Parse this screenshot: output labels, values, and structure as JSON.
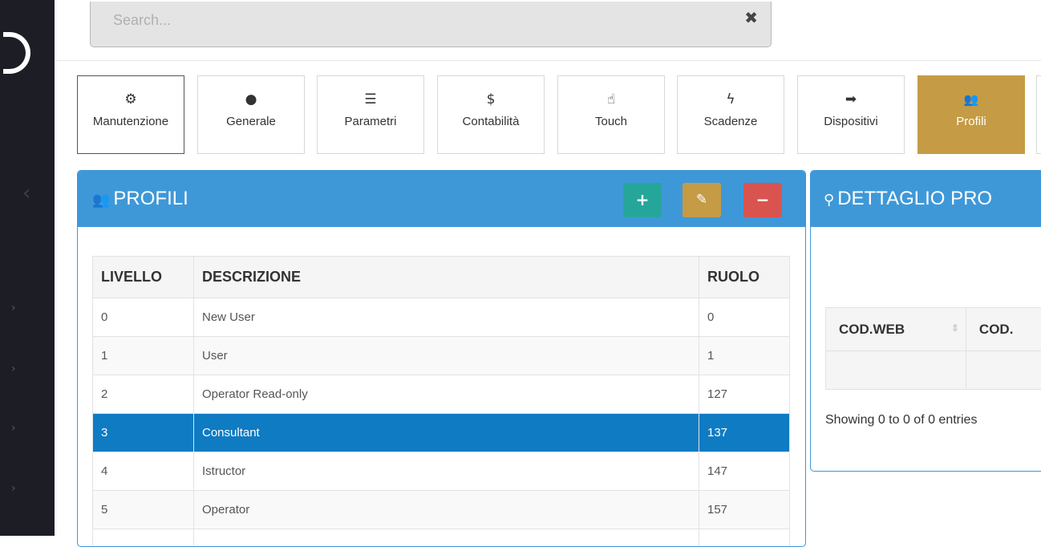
{
  "sidebar": {
    "collapse_icon": "chevron-left-icon",
    "item_icon": "chevron-right-icon"
  },
  "search": {
    "placeholder": "Search...",
    "value": "",
    "clear_icon": "close-icon"
  },
  "tiles": [
    {
      "label": "Manutenzione",
      "icon": "cogs-icon",
      "glyph": "⚙"
    },
    {
      "label": "Generale",
      "icon": "globe-icon",
      "glyph": "●"
    },
    {
      "label": "Parametri",
      "icon": "list-icon",
      "glyph": "☰"
    },
    {
      "label": "Contabilità",
      "icon": "dollar-icon",
      "glyph": "$"
    },
    {
      "label": "Touch",
      "icon": "hand-pointer-icon",
      "glyph": "☝"
    },
    {
      "label": "Scadenze",
      "icon": "bolt-icon",
      "glyph": "ϟ"
    },
    {
      "label": "Dispositivi",
      "icon": "sign-in-icon",
      "glyph": "➡"
    },
    {
      "label": "Profili",
      "icon": "users-icon",
      "glyph": "👥"
    }
  ],
  "profili": {
    "title": "PROFILI",
    "icon": "users-icon",
    "actions": {
      "add": "+",
      "edit": "✎",
      "remove": "−"
    },
    "colors": {
      "header": "#3e98d8",
      "add": "#26a69a",
      "edit": "#c59b45",
      "remove": "#d9534f",
      "selected": "#0f7bc2"
    },
    "columns": [
      "LIVELLO",
      "DESCRIZIONE",
      "RUOLO"
    ],
    "rows": [
      [
        "0",
        "New User",
        "0"
      ],
      [
        "1",
        "User",
        "1"
      ],
      [
        "2",
        "Operator Read-only",
        "127"
      ],
      [
        "3",
        "Consultant",
        "137"
      ],
      [
        "4",
        "Istructor",
        "147"
      ],
      [
        "5",
        "Operator",
        "157"
      ]
    ],
    "selected_row": 3
  },
  "dettaglio": {
    "title": "DETTAGLIO PRO",
    "icon": "search-icon",
    "columns": [
      "COD.WEB",
      "COD."
    ],
    "info": "Showing 0 to 0 of 0 entries"
  }
}
